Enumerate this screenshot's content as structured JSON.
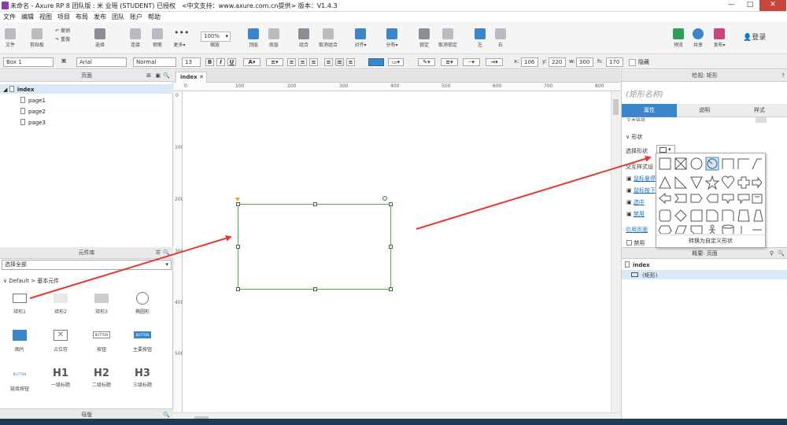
{
  "window": {
    "title": "未命名 - Axure RP 8 团队版 : 米 业瑶 (STUDENT) 已授权　<中文支持：www.axure.com.cn提供> 版本：V1.4.3",
    "min": "—",
    "max": "□",
    "close": "✕"
  },
  "menu": [
    "文件",
    "编辑",
    "视图",
    "项目",
    "布局",
    "发布",
    "团队",
    "账户",
    "帮助"
  ],
  "toolbar": {
    "file": "文件",
    "clipboard": "剪贴板",
    "undo": "撤销",
    "redo": "重做",
    "select": "选择",
    "connect": "连接",
    "pen": "钢笔",
    "more": "更多▾",
    "zoom_value": "100%",
    "zoom_label": "缩放",
    "top": "顶层",
    "bottom": "底层",
    "group": "组合",
    "ungroup": "取消组合",
    "align": "对齐▾",
    "distribute": "分布▾",
    "lock": "锁定",
    "unlock": "取消锁定",
    "left": "左",
    "right": "右",
    "preview": "预览",
    "share": "共享",
    "publish": "发布▾",
    "login": "登录"
  },
  "format": {
    "widget_name": "Box 1",
    "font": "Arial",
    "weight": "Normal",
    "size": "13",
    "x_label": "x:",
    "x": "106",
    "y_label": "y:",
    "y": "220",
    "w_label": "w:",
    "w": "300",
    "h_label": "h:",
    "h": "170",
    "hidden": "隐藏"
  },
  "pages": {
    "header": "页面",
    "root": "index",
    "children": [
      "page1",
      "page2",
      "page3"
    ]
  },
  "library": {
    "header": "元件库",
    "select_all": "选择全部",
    "group": "Default > 基本元件",
    "items": [
      {
        "label": "矩形1"
      },
      {
        "label": "矩形2"
      },
      {
        "label": "矩形3"
      },
      {
        "label": "椭圆形"
      },
      {
        "label": "图片"
      },
      {
        "label": "占位符"
      },
      {
        "label": "按钮",
        "tag": "BUTTON"
      },
      {
        "label": "主要按钮",
        "tag": "BUTTON"
      },
      {
        "label": "链接按钮",
        "tag": "BUTTON"
      },
      {
        "label": "一级标题",
        "tag": "H1"
      },
      {
        "label": "二级标题",
        "tag": "H2"
      },
      {
        "label": "三级标题",
        "tag": "H3"
      }
    ],
    "masters": "母版"
  },
  "canvas": {
    "tab": "index",
    "ruler_h": [
      "0",
      "100",
      "200",
      "300",
      "400",
      "500",
      "600",
      "700",
      "800"
    ],
    "ruler_v": [
      "0",
      "100",
      "200",
      "300",
      "400",
      "500"
    ]
  },
  "inspector": {
    "header": "检视: 矩形",
    "name_placeholder": "(矩形名称)",
    "tabs": [
      "属性",
      "说明",
      "样式"
    ],
    "text_link": "文本链接",
    "shape_section": "形状",
    "select_shape": "选择形状",
    "interaction": "交互样式设",
    "links": [
      "鼠标悬停",
      "鼠标按下",
      "选中",
      "禁用"
    ],
    "ref_page": "引用页面",
    "disabled": "禁用",
    "convert": "转换为自定义形状"
  },
  "outline": {
    "header": "概要: 页面",
    "root": "index",
    "child": "(矩形)"
  },
  "colors": {
    "accent": "#3a86c8",
    "selection": "#4caf50",
    "arrow": "#e53935"
  }
}
